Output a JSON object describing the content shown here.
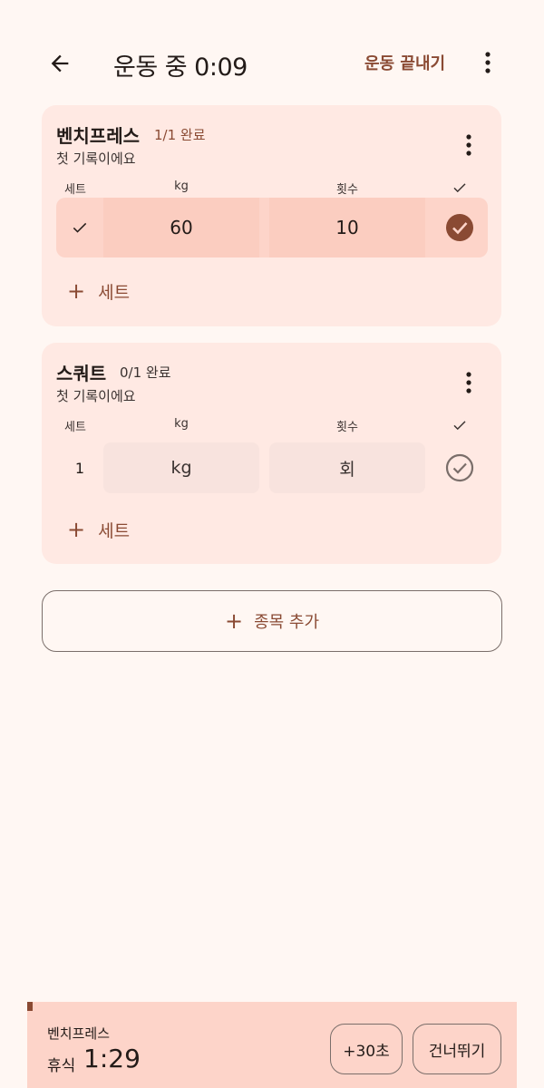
{
  "appbar": {
    "title": "운동 중 0:09",
    "end_label": "운동 끝내기"
  },
  "table_headers": {
    "set": "세트",
    "kg": "kg",
    "reps": "횟수"
  },
  "exercises": [
    {
      "name": "벤치프레스",
      "progress": "1/1 완료",
      "note": "첫 기록이에요",
      "sets": [
        {
          "kg": "60",
          "reps": "10",
          "completed": true
        }
      ],
      "add_set_label": "세트"
    },
    {
      "name": "스쿼트",
      "progress": "0/1 완료",
      "note": "첫 기록이에요",
      "sets": [
        {
          "number": "1",
          "kg_placeholder": "kg",
          "reps_placeholder": "회",
          "completed": false
        }
      ],
      "add_set_label": "세트"
    }
  ],
  "add_exercise_label": "종목 추가",
  "rest_timer": {
    "exercise": "벤치프레스",
    "label": "휴식",
    "time": "1:29",
    "add_time_label": "+30초",
    "skip_label": "건너뛰기"
  },
  "colors": {
    "accent": "#8a4a33",
    "background": "#fff7f3",
    "card": "#ffe9e3",
    "completed_row": "#fdd4c9"
  },
  "icons": {
    "back": "arrow-left-icon",
    "more": "more-vertical-icon",
    "check": "check-icon",
    "check_circle": "check-circle-icon",
    "add": "plus-icon"
  }
}
